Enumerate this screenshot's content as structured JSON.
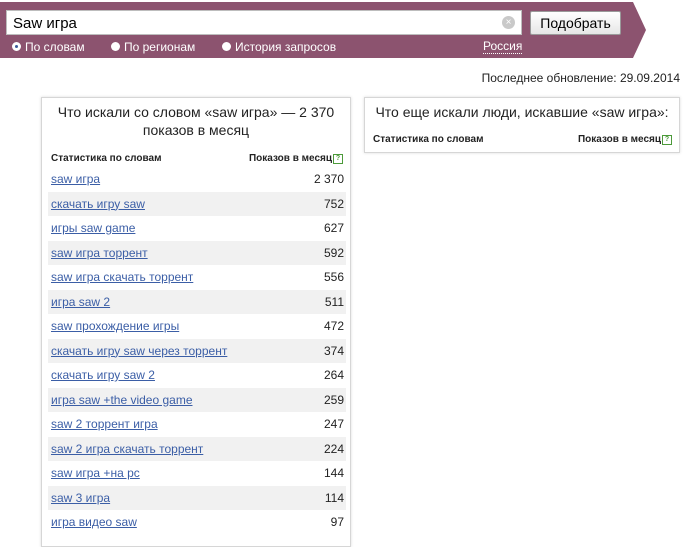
{
  "header": {
    "search_value": "Saw игра",
    "clear_icon": "clear-icon",
    "pick_button_label": "Подобрать",
    "bar_color": "#8c536f",
    "radios": [
      {
        "label": "По словам",
        "checked": true
      },
      {
        "label": "По регионам",
        "checked": false
      },
      {
        "label": "История запросов",
        "checked": false
      }
    ],
    "region_link": "Россия"
  },
  "updated_text": "Последнее обновление: 29.09.2014",
  "left_panel": {
    "title": "Что искали со словом «saw игра» — 2 370 показов в месяц",
    "col_stats": "Статистика по словам",
    "col_shows": "Показов в месяц",
    "help_icon": "?",
    "rows": [
      {
        "phrase": "saw игра",
        "count": "2 370"
      },
      {
        "phrase": "скачать игру saw",
        "count": "752"
      },
      {
        "phrase": "игры saw game",
        "count": "627"
      },
      {
        "phrase": "saw игра торрент",
        "count": "592"
      },
      {
        "phrase": "saw игра скачать торрент",
        "count": "556"
      },
      {
        "phrase": "игра saw 2",
        "count": "511"
      },
      {
        "phrase": "saw прохождение игры",
        "count": "472"
      },
      {
        "phrase": "скачать игру saw через торрент",
        "count": "374"
      },
      {
        "phrase": "скачать игру saw 2",
        "count": "264"
      },
      {
        "phrase": "игра saw +the video game",
        "count": "259"
      },
      {
        "phrase": "saw 2 торрент игра",
        "count": "247"
      },
      {
        "phrase": "saw 2 игра скачать торрент",
        "count": "224"
      },
      {
        "phrase": "saw игра +на pc",
        "count": "144"
      },
      {
        "phrase": "saw 3 игра",
        "count": "114"
      },
      {
        "phrase": "игра видео saw",
        "count": "97"
      }
    ]
  },
  "right_panel": {
    "title": "Что еще искали люди, искавшие «saw игра»:",
    "col_stats": "Статистика по словам",
    "col_shows": "Показов в месяц",
    "help_icon": "?"
  }
}
